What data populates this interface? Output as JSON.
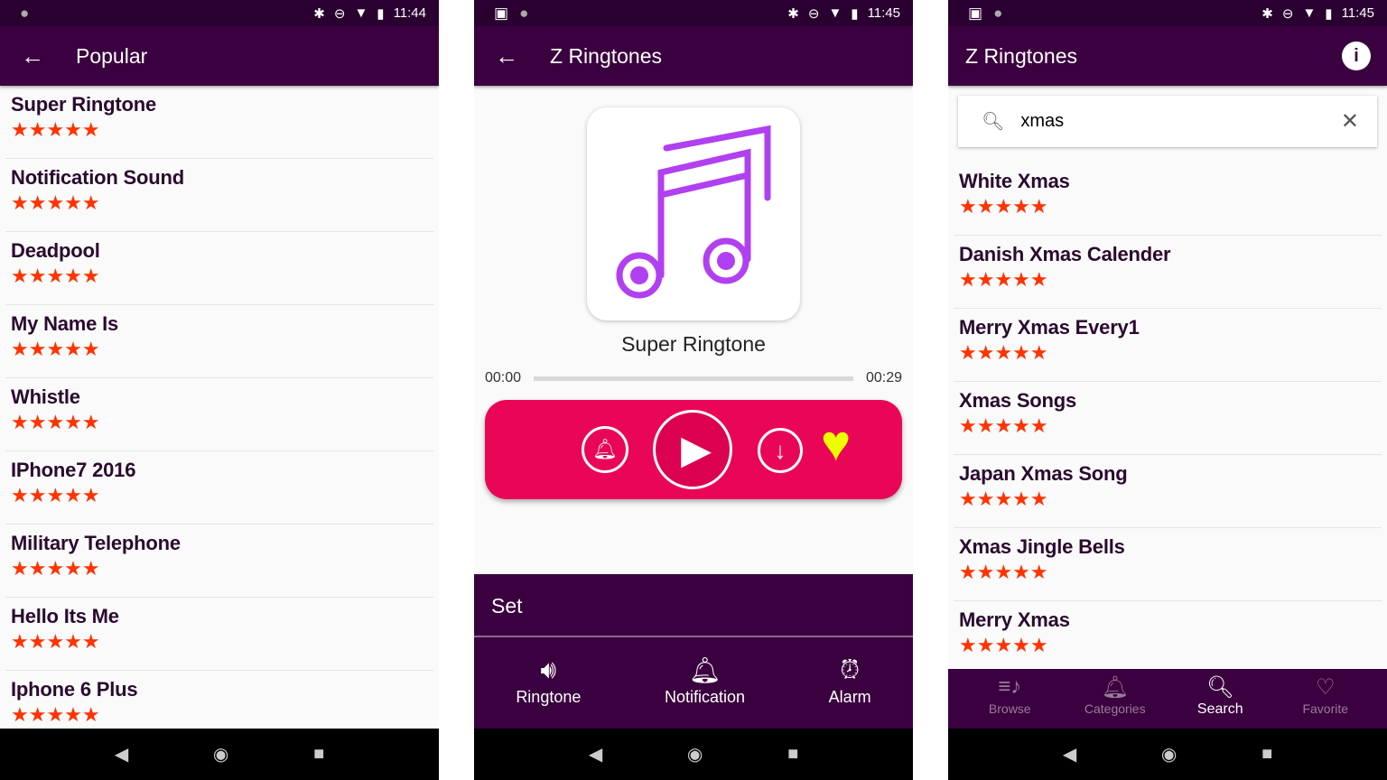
{
  "colors": {
    "status_bar": "#2a0031",
    "app_bar": "#3b003f",
    "player": "#ea0657",
    "heart": "#f0ff00",
    "stars": "#ff3300"
  },
  "screen1": {
    "status": {
      "time": "11:44"
    },
    "title": "Popular",
    "rating_stars": 5,
    "items": [
      {
        "title": "Super Ringtone",
        "stars": "★★★★★"
      },
      {
        "title": "Notification Sound",
        "stars": "★★★★★"
      },
      {
        "title": "Deadpool",
        "stars": "★★★★★"
      },
      {
        "title": "My Name Is",
        "stars": "★★★★★"
      },
      {
        "title": "Whistle",
        "stars": "★★★★★"
      },
      {
        "title": "IPhone7  2016",
        "stars": "★★★★★"
      },
      {
        "title": "Military Telephone",
        "stars": "★★★★★"
      },
      {
        "title": "Hello Its Me",
        "stars": "★★★★★"
      },
      {
        "title": "Iphone 6 Plus",
        "stars": "★★★★★"
      }
    ]
  },
  "screen2": {
    "status": {
      "time": "11:45"
    },
    "title": "Z Ringtones",
    "song": "Super Ringtone",
    "current_time": "00:00",
    "duration": "00:29",
    "progress": 0,
    "set": {
      "header": "Set",
      "options": [
        {
          "label": "Ringtone",
          "icon": "speaker-icon"
        },
        {
          "label": "Notification",
          "icon": "bell-icon"
        },
        {
          "label": "Alarm",
          "icon": "alarm-clock-icon"
        }
      ]
    }
  },
  "screen3": {
    "status": {
      "time": "11:45"
    },
    "title": "Z Ringtones",
    "search": {
      "value": "xmas"
    },
    "items": [
      {
        "title": "White Xmas",
        "stars": "★★★★★"
      },
      {
        "title": "Danish Xmas Calender",
        "stars": "★★★★★"
      },
      {
        "title": "Merry Xmas Every1",
        "stars": "★★★★★"
      },
      {
        "title": "Xmas Songs",
        "stars": "★★★★★"
      },
      {
        "title": "Japan Xmas Song",
        "stars": "★★★★★"
      },
      {
        "title": "Xmas Jingle Bells",
        "stars": "★★★★★"
      },
      {
        "title": "Merry Xmas",
        "stars": "★★★★★"
      }
    ],
    "tabs": [
      {
        "label": "Browse",
        "icon": "music-list-icon"
      },
      {
        "label": "Categories",
        "icon": "bells-icon"
      },
      {
        "label": "Search",
        "icon": "search-icon",
        "active": true
      },
      {
        "label": "Favorite",
        "icon": "hearts-icon"
      }
    ]
  }
}
